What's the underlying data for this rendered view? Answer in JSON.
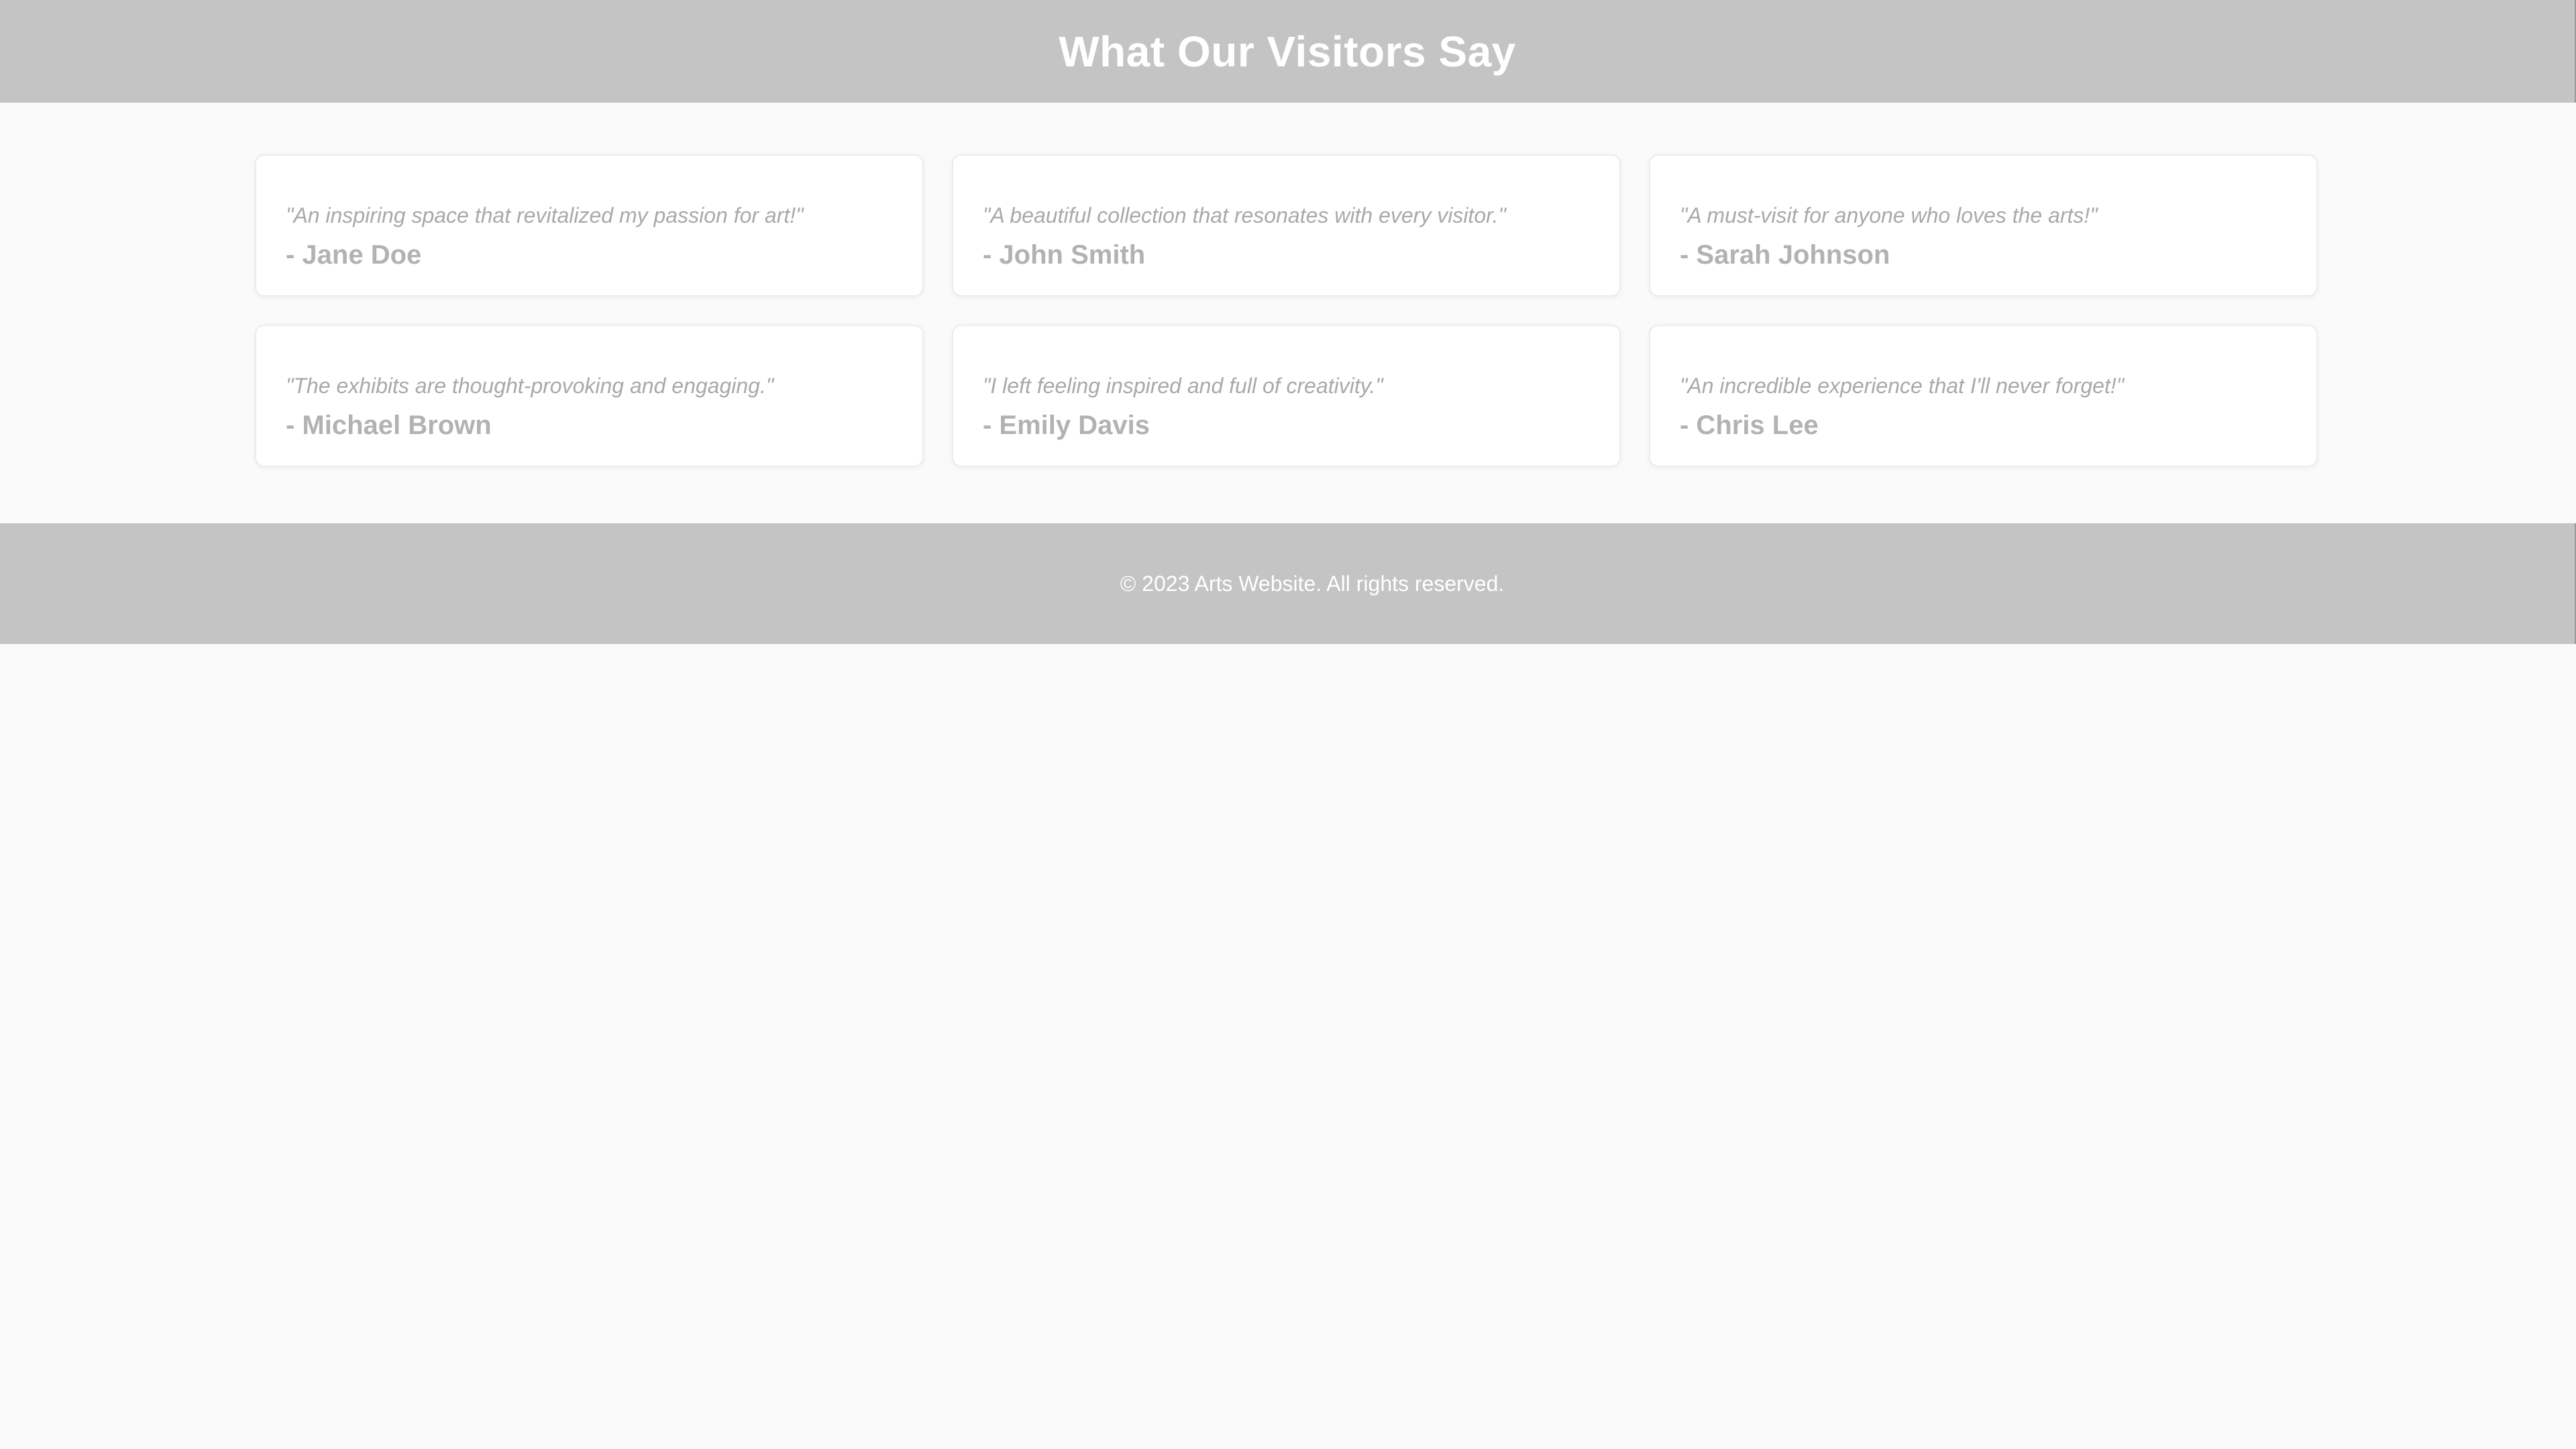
{
  "header": {
    "title": "What Our Visitors Say"
  },
  "testimonials": [
    {
      "quote": "\"An inspiring space that revitalized my passion for art!\"",
      "author": "- Jane Doe"
    },
    {
      "quote": "\"A beautiful collection that resonates with every visitor.\"",
      "author": "- John Smith"
    },
    {
      "quote": "\"A must-visit for anyone who loves the arts!\"",
      "author": "- Sarah Johnson"
    },
    {
      "quote": "\"The exhibits are thought-provoking and engaging.\"",
      "author": "- Michael Brown"
    },
    {
      "quote": "\"I left feeling inspired and full of creativity.\"",
      "author": "- Emily Davis"
    },
    {
      "quote": "\"An incredible experience that I'll never forget!\"",
      "author": "- Chris Lee"
    }
  ],
  "footer": {
    "text": "© 2023 Arts Website. All rights reserved."
  },
  "colors": {
    "header_bg": "#c4c4c4",
    "page_bg": "#fafafa",
    "card_bg": "#ffffff"
  }
}
